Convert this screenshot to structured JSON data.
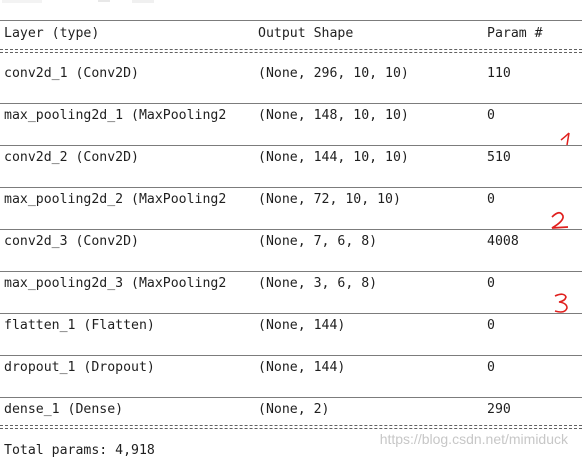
{
  "header": {
    "layer": "Layer (type)",
    "output_shape": "Output Shape",
    "params": "Param #"
  },
  "rows": [
    {
      "layer": "conv2d_1 (Conv2D)",
      "shape": "(None, 296, 10, 10)",
      "params": "110"
    },
    {
      "layer": "max_pooling2d_1 (MaxPooling2",
      "shape": "(None, 148, 10, 10)",
      "params": "0"
    },
    {
      "layer": "conv2d_2 (Conv2D)",
      "shape": "(None, 144, 10, 10)",
      "params": "510"
    },
    {
      "layer": "max_pooling2d_2 (MaxPooling2",
      "shape": "(None, 72, 10, 10)",
      "params": "0"
    },
    {
      "layer": "conv2d_3 (Conv2D)",
      "shape": "(None, 7, 6, 8)",
      "params": "4008"
    },
    {
      "layer": "max_pooling2d_3 (MaxPooling2",
      "shape": "(None, 3, 6, 8)",
      "params": "0"
    },
    {
      "layer": "flatten_1 (Flatten)",
      "shape": "(None, 144)",
      "params": "0"
    },
    {
      "layer": "dropout_1 (Dropout)",
      "shape": "(None, 144)",
      "params": "0"
    },
    {
      "layer": "dense_1 (Dense)",
      "shape": "(None, 2)",
      "params": "290"
    }
  ],
  "total": "Total params: 4,918",
  "watermark": "https://blog.csdn.net/mimiduck",
  "annotations": [
    "1",
    "2",
    "3"
  ],
  "colors": {
    "annotation": "#e0201e",
    "text": "#1f1f1f",
    "watermark": "#c7c7c7"
  }
}
